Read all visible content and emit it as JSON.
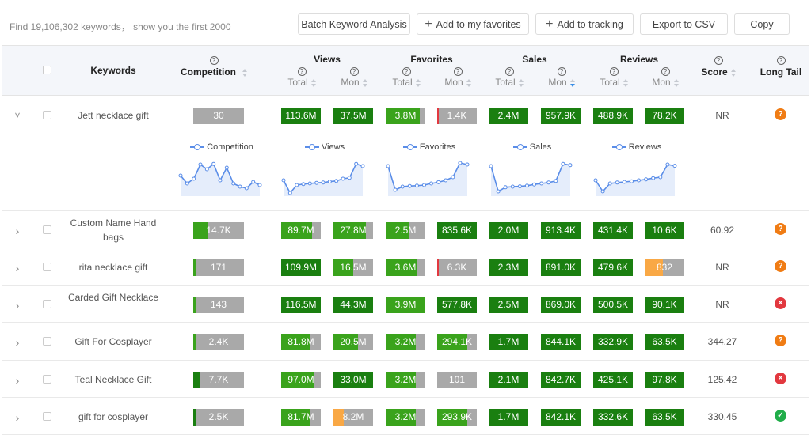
{
  "summary": "Find 19,106,302 keywords， show you the first 2000",
  "toolbar": {
    "batch_label": "Batch Keyword Analysis",
    "favorites_label": "Add to my favorites",
    "tracking_label": "Add to tracking",
    "export_label": "Export to CSV",
    "copy_label": "Copy"
  },
  "header": {
    "keywords": "Keywords",
    "competition": "Competition",
    "views": "Views",
    "favorites": "Favorites",
    "sales": "Sales",
    "reviews": "Reviews",
    "score": "Score",
    "long_tail": "Long Tail",
    "total": "Total",
    "mon": "Mon",
    "help_glyph": "?"
  },
  "colors": {
    "dark_green": "#1a7f10",
    "green": "#3aa31c",
    "grey": "#a9a9a9",
    "orange": "#f9a845",
    "red": "#e2383f",
    "sparkline": "#5a8de8"
  },
  "sparkline_legend": [
    "Competition",
    "Views",
    "Favorites",
    "Sales",
    "Reviews"
  ],
  "sparklines": [
    [
      0.55,
      0.3,
      0.45,
      0.9,
      0.75,
      0.92,
      0.4,
      0.8,
      0.3,
      0.2,
      0.15,
      0.35,
      0.25
    ],
    [
      0.4,
      0.0,
      0.25,
      0.28,
      0.3,
      0.32,
      0.33,
      0.36,
      0.38,
      0.45,
      0.48,
      0.92,
      0.85
    ],
    [
      0.85,
      0.1,
      0.2,
      0.22,
      0.23,
      0.25,
      0.3,
      0.34,
      0.4,
      0.5,
      0.95,
      0.9
    ],
    [
      0.85,
      0.05,
      0.18,
      0.2,
      0.21,
      0.23,
      0.27,
      0.3,
      0.33,
      0.38,
      0.92,
      0.88
    ],
    [
      0.4,
      0.05,
      0.3,
      0.33,
      0.35,
      0.37,
      0.4,
      0.43,
      0.47,
      0.5,
      0.9,
      0.86
    ]
  ],
  "rows": [
    {
      "keyword": "Jett necklace gift",
      "expanded": true,
      "competition": {
        "text": "30",
        "fill": 0.0,
        "color": "grey"
      },
      "views_total": {
        "text": "113.6M",
        "fill": 1.0,
        "color": "dark_green"
      },
      "views_mon": {
        "text": "37.5M",
        "fill": 1.0,
        "color": "dark_green"
      },
      "fav_total": {
        "text": "3.8M",
        "fill": 0.85,
        "color": "green"
      },
      "fav_mon": {
        "text": "1.4K",
        "fill": 0.03,
        "color": "red"
      },
      "sales_total": {
        "text": "2.4M",
        "fill": 1.0,
        "color": "dark_green"
      },
      "sales_mon": {
        "text": "957.9K",
        "fill": 1.0,
        "color": "dark_green"
      },
      "rev_total": {
        "text": "488.9K",
        "fill": 1.0,
        "color": "dark_green"
      },
      "rev_mon": {
        "text": "78.2K",
        "fill": 1.0,
        "color": "dark_green"
      },
      "score": "NR",
      "long_tail": "question"
    },
    {
      "keyword": "Custom Name Hand bags",
      "expanded": false,
      "competition": {
        "text": "14.7K",
        "fill": 0.28,
        "color": "green"
      },
      "views_total": {
        "text": "89.7M",
        "fill": 0.78,
        "color": "green"
      },
      "views_mon": {
        "text": "27.8M",
        "fill": 0.82,
        "color": "green"
      },
      "fav_total": {
        "text": "2.5M",
        "fill": 0.6,
        "color": "green"
      },
      "fav_mon": {
        "text": "835.6K",
        "fill": 1.0,
        "color": "dark_green"
      },
      "sales_total": {
        "text": "2.0M",
        "fill": 1.0,
        "color": "dark_green"
      },
      "sales_mon": {
        "text": "913.4K",
        "fill": 1.0,
        "color": "dark_green"
      },
      "rev_total": {
        "text": "431.4K",
        "fill": 1.0,
        "color": "dark_green"
      },
      "rev_mon": {
        "text": "10.6K",
        "fill": 1.0,
        "color": "dark_green"
      },
      "score": "60.92",
      "long_tail": "question"
    },
    {
      "keyword": "rita necklace gift",
      "expanded": false,
      "competition": {
        "text": "171",
        "fill": 0.02,
        "color": "green"
      },
      "views_total": {
        "text": "109.9M",
        "fill": 1.0,
        "color": "dark_green"
      },
      "views_mon": {
        "text": "16.5M",
        "fill": 0.5,
        "color": "green"
      },
      "fav_total": {
        "text": "3.6M",
        "fill": 0.8,
        "color": "green"
      },
      "fav_mon": {
        "text": "6.3K",
        "fill": 0.03,
        "color": "red"
      },
      "sales_total": {
        "text": "2.3M",
        "fill": 1.0,
        "color": "dark_green"
      },
      "sales_mon": {
        "text": "891.0K",
        "fill": 1.0,
        "color": "dark_green"
      },
      "rev_total": {
        "text": "479.6K",
        "fill": 1.0,
        "color": "dark_green"
      },
      "rev_mon": {
        "text": "832",
        "fill": 0.45,
        "color": "orange"
      },
      "score": "NR",
      "long_tail": "question"
    },
    {
      "keyword": "Carded Gift Necklace",
      "expanded": false,
      "competition": {
        "text": "143",
        "fill": 0.02,
        "color": "green"
      },
      "views_total": {
        "text": "116.5M",
        "fill": 1.0,
        "color": "dark_green"
      },
      "views_mon": {
        "text": "44.3M",
        "fill": 1.0,
        "color": "dark_green"
      },
      "fav_total": {
        "text": "3.9M",
        "fill": 1.0,
        "color": "green"
      },
      "fav_mon": {
        "text": "577.8K",
        "fill": 1.0,
        "color": "dark_green"
      },
      "sales_total": {
        "text": "2.5M",
        "fill": 1.0,
        "color": "dark_green"
      },
      "sales_mon": {
        "text": "869.0K",
        "fill": 1.0,
        "color": "dark_green"
      },
      "rev_total": {
        "text": "500.5K",
        "fill": 1.0,
        "color": "dark_green"
      },
      "rev_mon": {
        "text": "90.1K",
        "fill": 1.0,
        "color": "dark_green"
      },
      "score": "NR",
      "long_tail": "cross"
    },
    {
      "keyword": "Gift For Cosplayer",
      "expanded": false,
      "competition": {
        "text": "2.4K",
        "fill": 0.04,
        "color": "green"
      },
      "views_total": {
        "text": "81.8M",
        "fill": 0.72,
        "color": "green"
      },
      "views_mon": {
        "text": "20.5M",
        "fill": 0.62,
        "color": "green"
      },
      "fav_total": {
        "text": "3.2M",
        "fill": 0.75,
        "color": "green"
      },
      "fav_mon": {
        "text": "294.1K",
        "fill": 0.75,
        "color": "green"
      },
      "sales_total": {
        "text": "1.7M",
        "fill": 1.0,
        "color": "dark_green"
      },
      "sales_mon": {
        "text": "844.1K",
        "fill": 1.0,
        "color": "dark_green"
      },
      "rev_total": {
        "text": "332.9K",
        "fill": 1.0,
        "color": "dark_green"
      },
      "rev_mon": {
        "text": "63.5K",
        "fill": 1.0,
        "color": "dark_green"
      },
      "score": "344.27",
      "long_tail": "question"
    },
    {
      "keyword": "Teal Necklace Gift",
      "expanded": false,
      "competition": {
        "text": "7.7K",
        "fill": 0.14,
        "color": "dark_green"
      },
      "views_total": {
        "text": "97.0M",
        "fill": 0.82,
        "color": "green"
      },
      "views_mon": {
        "text": "33.0M",
        "fill": 1.0,
        "color": "dark_green"
      },
      "fav_total": {
        "text": "3.2M",
        "fill": 0.75,
        "color": "green"
      },
      "fav_mon": {
        "text": "101",
        "fill": 0.0,
        "color": "grey"
      },
      "sales_total": {
        "text": "2.1M",
        "fill": 1.0,
        "color": "dark_green"
      },
      "sales_mon": {
        "text": "842.7K",
        "fill": 1.0,
        "color": "dark_green"
      },
      "rev_total": {
        "text": "425.1K",
        "fill": 1.0,
        "color": "dark_green"
      },
      "rev_mon": {
        "text": "97.8K",
        "fill": 1.0,
        "color": "dark_green"
      },
      "score": "125.42",
      "long_tail": "cross"
    },
    {
      "keyword": "gift for cosplayer",
      "expanded": false,
      "competition": {
        "text": "2.5K",
        "fill": 0.04,
        "color": "dark_green"
      },
      "views_total": {
        "text": "81.7M",
        "fill": 0.72,
        "color": "green"
      },
      "views_mon": {
        "text": "8.2M",
        "fill": 0.25,
        "color": "orange"
      },
      "fav_total": {
        "text": "3.2M",
        "fill": 0.75,
        "color": "green"
      },
      "fav_mon": {
        "text": "293.9K",
        "fill": 0.75,
        "color": "green"
      },
      "sales_total": {
        "text": "1.7M",
        "fill": 1.0,
        "color": "dark_green"
      },
      "sales_mon": {
        "text": "842.1K",
        "fill": 1.0,
        "color": "dark_green"
      },
      "rev_total": {
        "text": "332.6K",
        "fill": 1.0,
        "color": "dark_green"
      },
      "rev_mon": {
        "text": "63.5K",
        "fill": 1.0,
        "color": "dark_green"
      },
      "score": "330.45",
      "long_tail": "check"
    }
  ]
}
